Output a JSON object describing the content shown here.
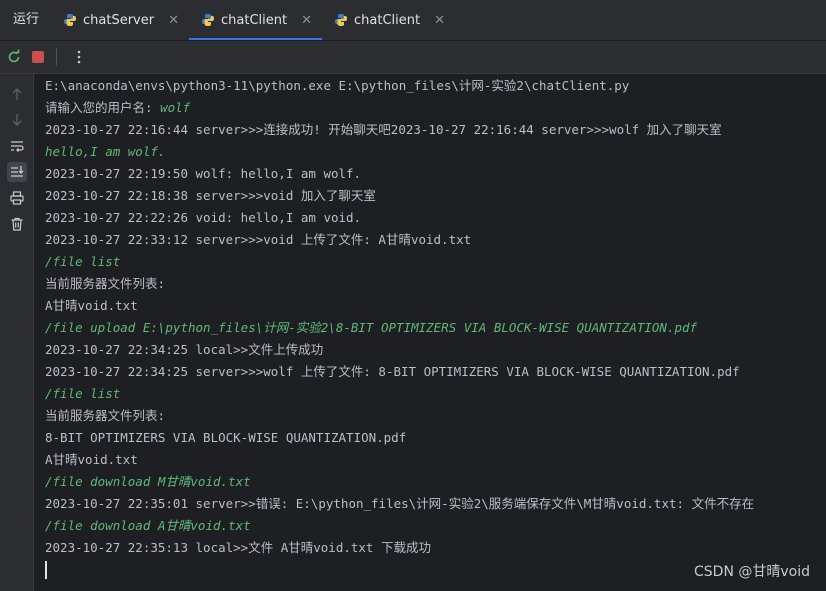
{
  "run_panel": {
    "title": "运行"
  },
  "tabs": [
    {
      "label": "chatServer",
      "active": false
    },
    {
      "label": "chatClient",
      "active": true
    },
    {
      "label": "chatClient",
      "active": false
    }
  ],
  "toolbar": {
    "icons": [
      "rerun-icon",
      "stop-icon",
      "more-icon"
    ]
  },
  "sidebar": {
    "icons": [
      "up-arrow-icon",
      "down-arrow-icon",
      "soft-wrap-icon",
      "scroll-to-end-icon",
      "print-icon",
      "trash-icon"
    ]
  },
  "console": {
    "lines": [
      {
        "parts": [
          {
            "t": "E:\\anaconda\\envs\\python3-11\\python.exe E:\\python_files\\计网-实验2\\chatClient.py",
            "k": "out"
          }
        ]
      },
      {
        "parts": [
          {
            "t": "请输入您的用户名: ",
            "k": "out"
          },
          {
            "t": "wolf",
            "k": "in"
          }
        ]
      },
      {
        "parts": [
          {
            "t": "2023-10-27 22:16:44 server>>>连接成功! 开始聊天吧2023-10-27 22:16:44 server>>>wolf 加入了聊天室",
            "k": "out"
          }
        ]
      },
      {
        "parts": [
          {
            "t": "hello,I am wolf.",
            "k": "in"
          }
        ]
      },
      {
        "parts": [
          {
            "t": "2023-10-27 22:19:50 wolf: hello,I am wolf.",
            "k": "out"
          }
        ]
      },
      {
        "parts": [
          {
            "t": "2023-10-27 22:18:38 server>>>void 加入了聊天室",
            "k": "out"
          }
        ]
      },
      {
        "parts": [
          {
            "t": "2023-10-27 22:22:26 void: hello,I am void.",
            "k": "out"
          }
        ]
      },
      {
        "parts": [
          {
            "t": "2023-10-27 22:33:12 server>>>void 上传了文件: A甘晴void.txt",
            "k": "out"
          }
        ]
      },
      {
        "parts": [
          {
            "t": "/file list",
            "k": "in"
          }
        ]
      },
      {
        "parts": [
          {
            "t": "当前服务器文件列表:",
            "k": "out"
          }
        ]
      },
      {
        "parts": [
          {
            "t": "A甘晴void.txt",
            "k": "out"
          }
        ]
      },
      {
        "parts": [
          {
            "t": "/file upload E:\\python_files\\计网-实验2\\8-BIT OPTIMIZERS VIA BLOCK-WISE QUANTIZATION.pdf",
            "k": "in"
          }
        ]
      },
      {
        "parts": [
          {
            "t": "2023-10-27 22:34:25 local>>文件上传成功",
            "k": "out"
          }
        ]
      },
      {
        "parts": [
          {
            "t": "2023-10-27 22:34:25 server>>>wolf 上传了文件: 8-BIT OPTIMIZERS VIA BLOCK-WISE QUANTIZATION.pdf",
            "k": "out"
          }
        ]
      },
      {
        "parts": [
          {
            "t": "/file list",
            "k": "in"
          }
        ]
      },
      {
        "parts": [
          {
            "t": "当前服务器文件列表:",
            "k": "out"
          }
        ]
      },
      {
        "parts": [
          {
            "t": "8-BIT OPTIMIZERS VIA BLOCK-WISE QUANTIZATION.pdf",
            "k": "out"
          }
        ]
      },
      {
        "parts": [
          {
            "t": "A甘晴void.txt",
            "k": "out"
          }
        ]
      },
      {
        "parts": [
          {
            "t": "/file download M甘晴void.txt",
            "k": "in"
          }
        ]
      },
      {
        "parts": [
          {
            "t": "2023-10-27 22:35:01 server>>错误: E:\\python_files\\计网-实验2\\服务端保存文件\\M甘晴void.txt: 文件不存在",
            "k": "out"
          }
        ]
      },
      {
        "parts": [
          {
            "t": "/file download A甘晴void.txt",
            "k": "in"
          }
        ]
      },
      {
        "parts": [
          {
            "t": "2023-10-27 22:35:13 local>>文件 A甘晴void.txt 下载成功",
            "k": "out"
          }
        ]
      }
    ]
  },
  "watermark": "CSDN @甘晴void",
  "colors": {
    "accent": "#3574f0",
    "input_text": "#5fb878",
    "output_text": "#bcbec4",
    "background": "#1e1f22"
  }
}
